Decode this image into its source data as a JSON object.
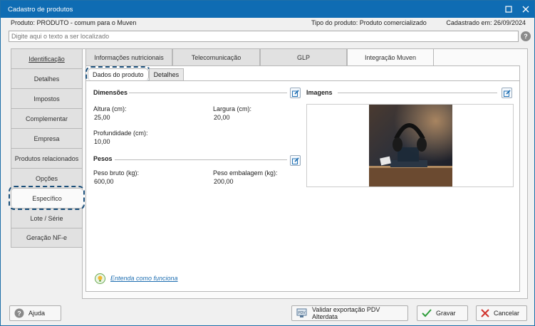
{
  "window": {
    "title": "Cadastro de produtos",
    "maximize_icon": "maximize-icon",
    "close_icon": "close-icon"
  },
  "info": {
    "product": "Produto: PRODUTO - comum para o Muven",
    "type": "Tipo do produto: Produto comercializado",
    "registered": "Cadastrado em: 26/09/2024"
  },
  "search": {
    "placeholder": "Digite aqui o texto a ser localizado",
    "help": "?"
  },
  "sidebar": {
    "items": [
      {
        "label": "Identificação"
      },
      {
        "label": "Detalhes"
      },
      {
        "label": "Impostos"
      },
      {
        "label": "Complementar"
      },
      {
        "label": "Empresa"
      },
      {
        "label": "Produtos relacionados"
      },
      {
        "label": "Opções"
      },
      {
        "label": "Específico"
      },
      {
        "label": "Lote / Série"
      },
      {
        "label": "Geração NF-e"
      }
    ]
  },
  "tabs": [
    {
      "label": "Informações nutricionais"
    },
    {
      "label": "Telecomunicação"
    },
    {
      "label": "GLP"
    },
    {
      "label": "Integração Muven"
    }
  ],
  "subtabs": [
    {
      "label": "Dados do produto"
    },
    {
      "label": "Detalhes"
    }
  ],
  "dimensions": {
    "title": "Dimensões",
    "altura_label": "Altura (cm):",
    "altura_value": "25,00",
    "largura_label": "Largura (cm):",
    "largura_value": "20,00",
    "profundidade_label": "Profundidade (cm):",
    "profundidade_value": "10,00"
  },
  "weights": {
    "title": "Pesos",
    "bruto_label": "Peso bruto (kg):",
    "bruto_value": "600,00",
    "embalagem_label": "Peso embalagem (kg):",
    "embalagem_value": "200,00"
  },
  "images": {
    "title": "Imagens"
  },
  "help_link": "Entenda como funciona",
  "footer": {
    "help": "Ajuda",
    "validate": "Validar exportação PDV Alterdata",
    "save": "Gravar",
    "cancel": "Cancelar"
  },
  "colors": {
    "titlebar": "#0f6cb3",
    "accent": "#1f6fb2",
    "save": "#2e9d3a",
    "cancel": "#d0322b"
  }
}
